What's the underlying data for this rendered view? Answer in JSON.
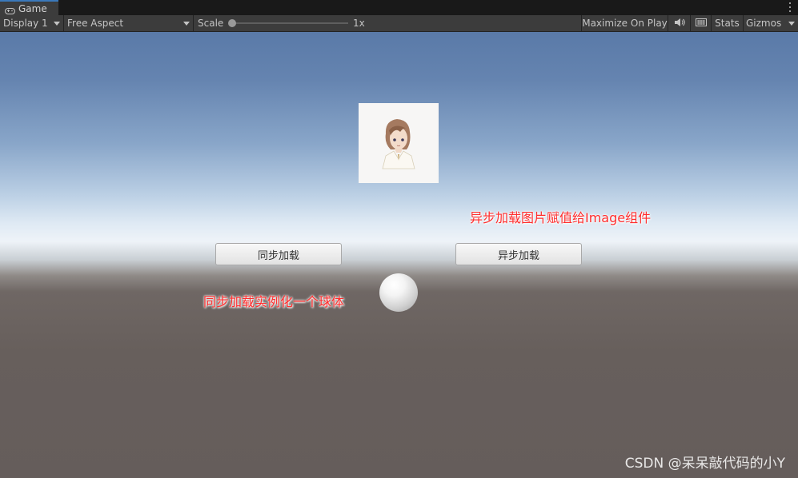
{
  "tab": {
    "title": "Game"
  },
  "toolbar": {
    "display": "Display 1",
    "aspect": "Free Aspect",
    "scale_label": "Scale",
    "scale_value": "1x",
    "scale_level": 0,
    "maximize": "Maximize On Play",
    "stats": "Stats",
    "gizmos": "Gizmos"
  },
  "game": {
    "sync_button": "同步加载",
    "async_button": "异步加载",
    "async_note": "异步加载图片赋值给Image组件",
    "sync_note": "同步加载实例化一个球体"
  },
  "watermark": "CSDN @呆呆敲代码的小Y",
  "colors": {
    "tab_accent": "#3a79bb",
    "toolbar_bg": "#3c3c3c",
    "note_text": "#ff2d2d"
  },
  "icons": [
    "gamepad-icon",
    "kebab-menu-icon",
    "speaker-icon",
    "keyboard-icon",
    "dropdown-arrow-icon"
  ]
}
